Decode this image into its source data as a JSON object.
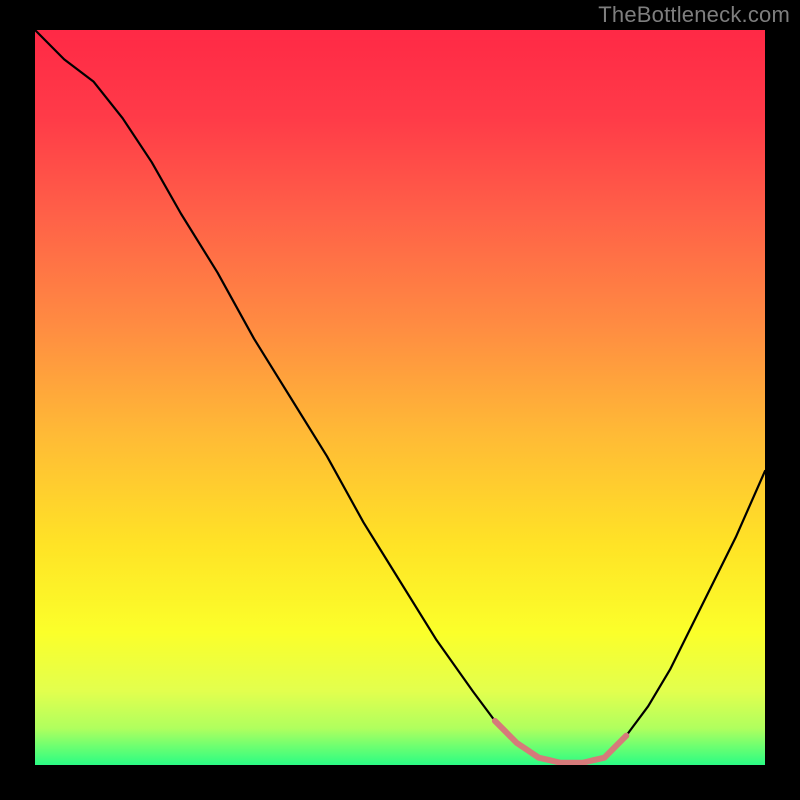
{
  "watermark": "TheBottleneck.com",
  "chart_data": {
    "type": "line",
    "title": "",
    "xlabel": "",
    "ylabel": "",
    "xlim": [
      0,
      100
    ],
    "ylim": [
      0,
      100
    ],
    "series": [
      {
        "name": "bottleneck-curve",
        "color": "#000000",
        "x": [
          0,
          4,
          8,
          12,
          16,
          20,
          25,
          30,
          35,
          40,
          45,
          50,
          55,
          60,
          63,
          66,
          69,
          72,
          75,
          78,
          81,
          84,
          87,
          90,
          93,
          96,
          100
        ],
        "y": [
          100,
          96,
          93,
          88,
          82,
          75,
          67,
          58,
          50,
          42,
          33,
          25,
          17,
          10,
          6,
          3,
          1,
          0.3,
          0.3,
          1,
          4,
          8,
          13,
          19,
          25,
          31,
          40
        ]
      }
    ],
    "optimal_range": {
      "x_start": 63,
      "x_end": 81,
      "color": "#d67a7a",
      "stroke_width": 6
    },
    "gradient_stops": [
      {
        "offset": 0.0,
        "color": "#ff2946"
      },
      {
        "offset": 0.12,
        "color": "#ff3b48"
      },
      {
        "offset": 0.25,
        "color": "#ff6048"
      },
      {
        "offset": 0.4,
        "color": "#ff8b42"
      },
      {
        "offset": 0.55,
        "color": "#ffba36"
      },
      {
        "offset": 0.7,
        "color": "#ffe326"
      },
      {
        "offset": 0.82,
        "color": "#fbff2a"
      },
      {
        "offset": 0.9,
        "color": "#e2ff4e"
      },
      {
        "offset": 0.95,
        "color": "#b0ff5e"
      },
      {
        "offset": 0.975,
        "color": "#6cff71"
      },
      {
        "offset": 1.0,
        "color": "#2bfc84"
      }
    ]
  }
}
